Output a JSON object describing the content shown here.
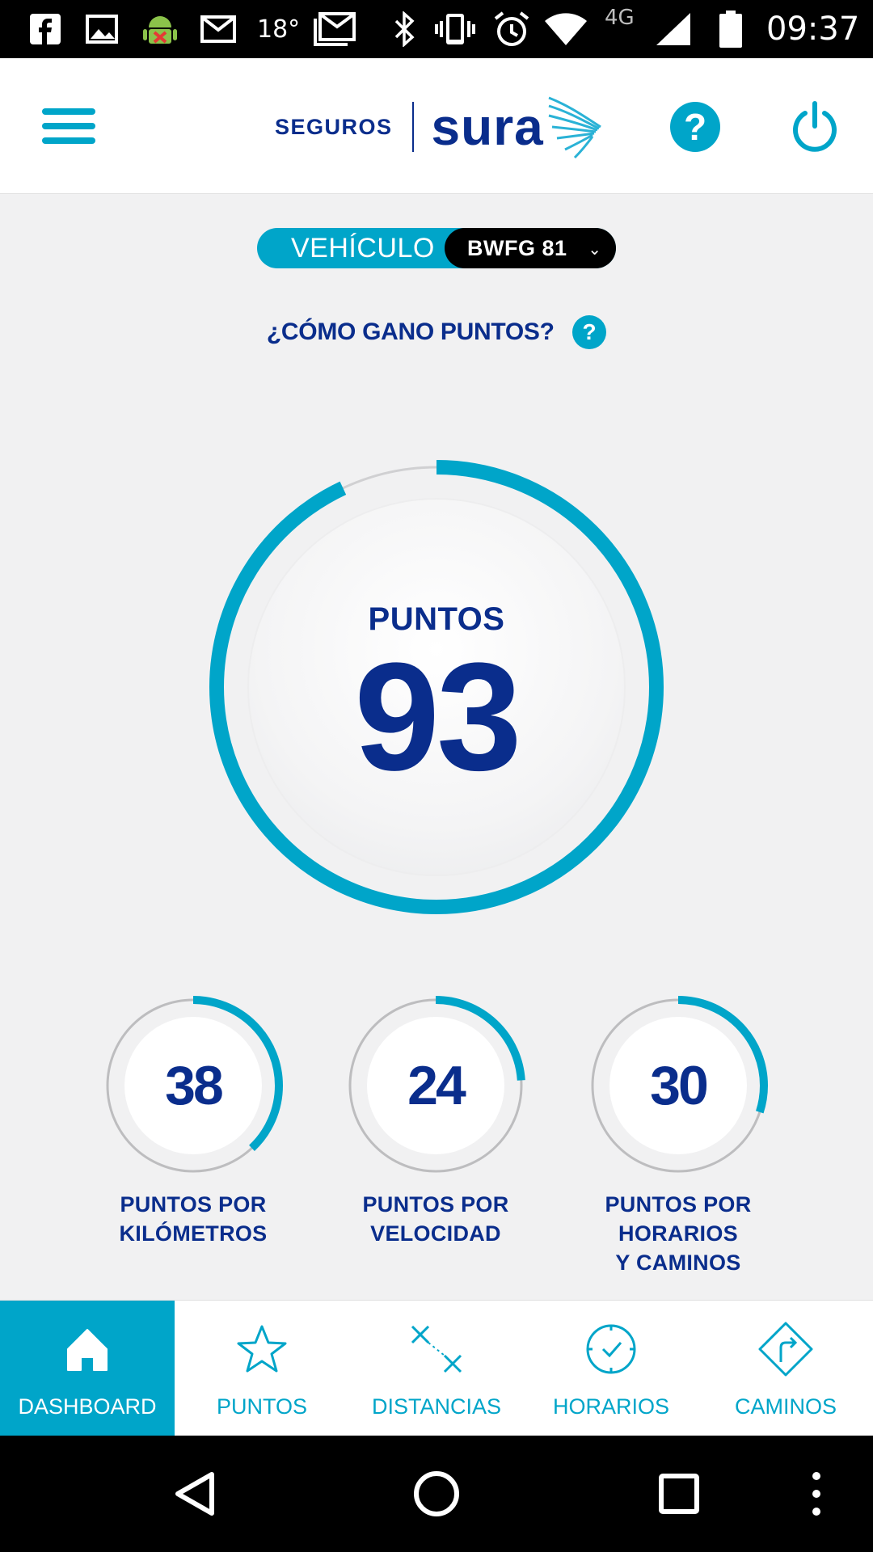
{
  "status_bar": {
    "temperature": "18°",
    "network": "4G",
    "time": "09:37"
  },
  "header": {
    "brand_seguros": "SEGUROS",
    "brand_sura": "sura",
    "help_label": "?"
  },
  "vehicle": {
    "label": "VEHÍCULO",
    "plate": "BWFG 81",
    "chevron": "⌄"
  },
  "how_earn": {
    "text": "¿CÓMO GANO PUNTOS?",
    "icon": "?"
  },
  "main_score": {
    "label": "PUNTOS",
    "value": "93",
    "progress": 0.93
  },
  "sub_scores": [
    {
      "value": "38",
      "caption_lines": [
        "PUNTOS POR",
        "KILÓMETROS"
      ],
      "progress": 0.38
    },
    {
      "value": "24",
      "caption_lines": [
        "PUNTOS POR",
        "VELOCIDAD"
      ],
      "progress": 0.24
    },
    {
      "value": "30",
      "caption_lines": [
        "PUNTOS POR",
        "HORARIOS",
        "Y CAMINOS"
      ],
      "progress": 0.3
    }
  ],
  "bottom_nav": [
    {
      "label": "DASHBOARD",
      "icon": "home-icon",
      "active": true
    },
    {
      "label": "PUNTOS",
      "icon": "star-icon",
      "active": false
    },
    {
      "label": "DISTANCIAS",
      "icon": "distance-icon",
      "active": false
    },
    {
      "label": "HORARIOS",
      "icon": "clock-icon",
      "active": false
    },
    {
      "label": "CAMINOS",
      "icon": "route-icon",
      "active": false
    }
  ],
  "colors": {
    "accent": "#00a5c9",
    "brand_blue": "#0a2d8c",
    "background": "#f1f1f2"
  }
}
